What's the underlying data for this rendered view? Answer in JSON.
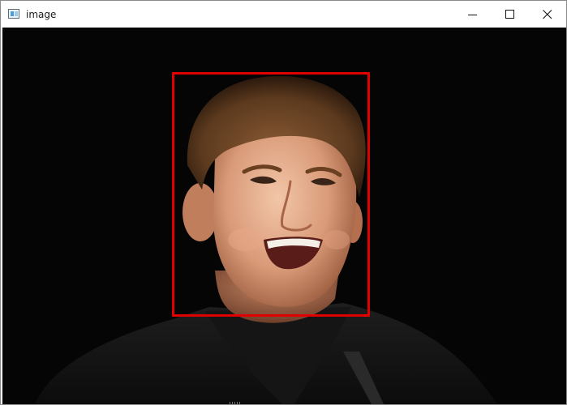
{
  "window": {
    "title": "image",
    "icon": "window-app-icon",
    "controls": {
      "minimize": "minimize-icon",
      "maximize": "maximize-icon",
      "close": "close-icon"
    }
  },
  "canvas": {
    "background_color": "#050505",
    "detection_box_color": "#e00000",
    "content": "photo-of-smiling-man-portrait"
  }
}
